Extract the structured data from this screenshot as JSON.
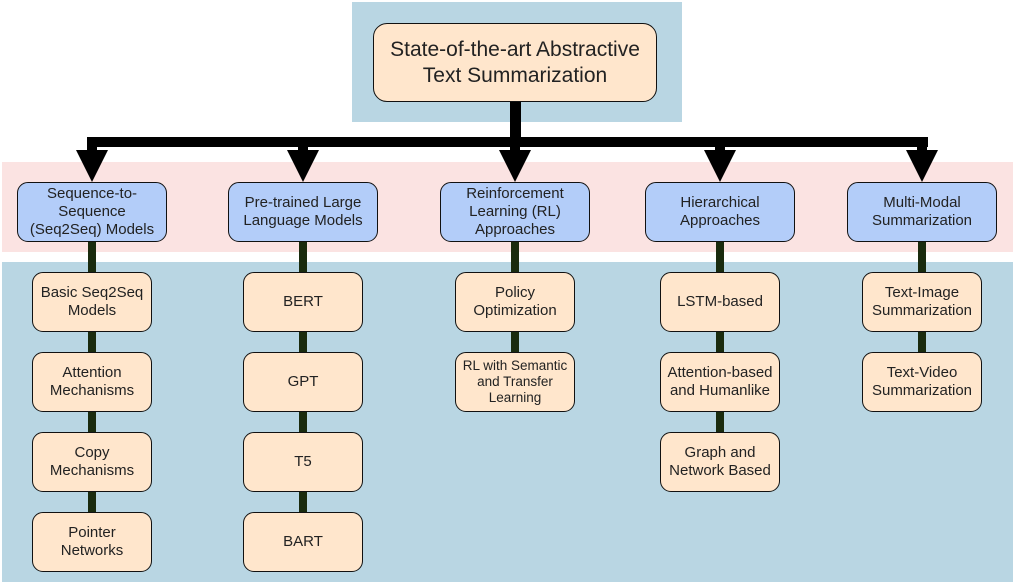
{
  "root": {
    "label": "State-of-the-art Abstractive Text Summarization"
  },
  "colors": {
    "band_blue": "#b9d6e3",
    "band_pink": "#fbe3e2",
    "category_fill": "#b3cdf9",
    "leaf_fill": "#ffe6cc",
    "arrow": "#000000",
    "child_connector": "#1a2b0e"
  },
  "categories": [
    {
      "label": "Sequence-to-Sequence (Seq2Seq) Models",
      "children": [
        "Basic Seq2Seq Models",
        "Attention Mechanisms",
        "Copy Mechanisms",
        "Pointer Networks"
      ]
    },
    {
      "label": "Pre-trained Large Language Models",
      "children": [
        "BERT",
        "GPT",
        "T5",
        "BART"
      ]
    },
    {
      "label": "Reinforcement Learning (RL) Approaches",
      "children": [
        "Policy Optimization",
        "RL with Semantic and Transfer Learning"
      ]
    },
    {
      "label": "Hierarchical Approaches",
      "children": [
        "LSTM-based",
        "Attention-based and Humanlike",
        "Graph and Network Based"
      ]
    },
    {
      "label": "Multi-Modal Summarization",
      "children": [
        "Text-Image Summarization",
        "Text-Video Summarization"
      ]
    }
  ]
}
